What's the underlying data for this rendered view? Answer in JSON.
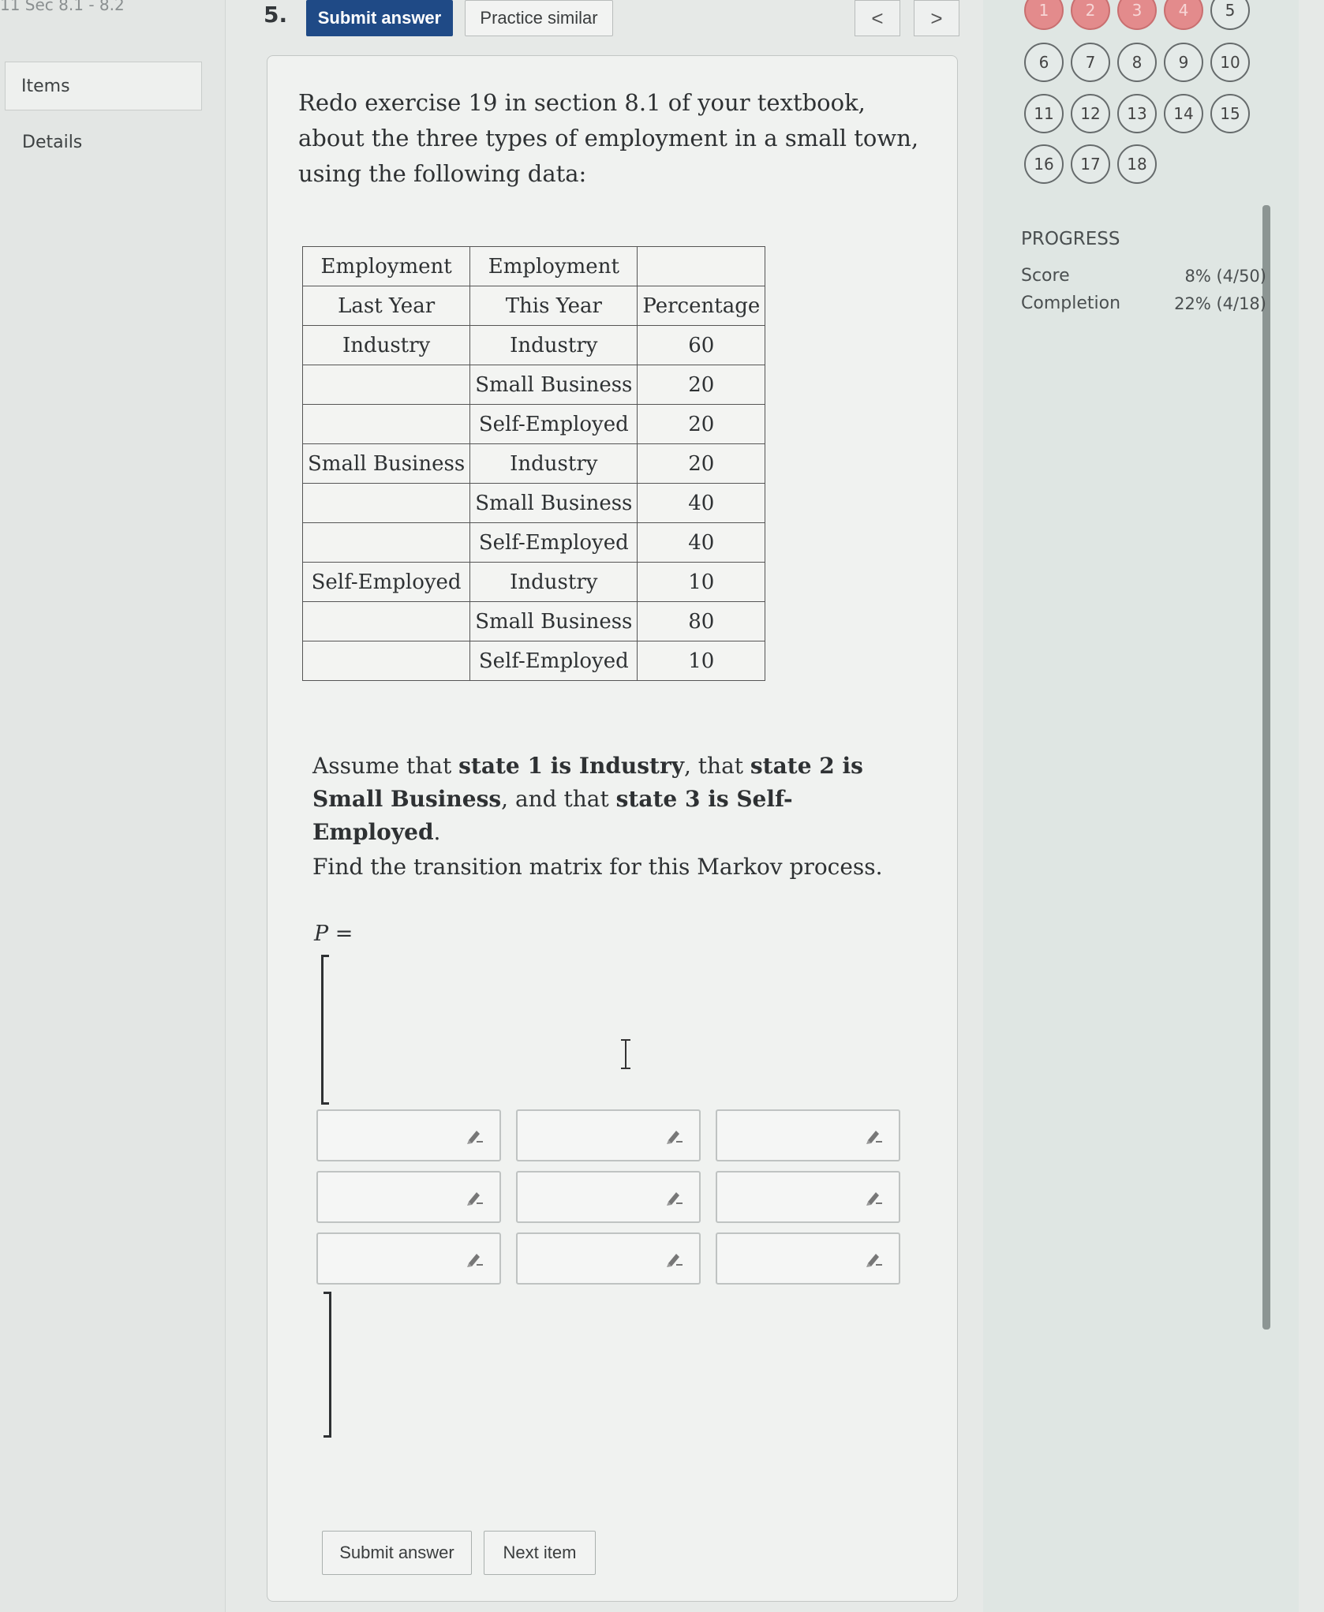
{
  "course_title": "11 Sec 8.1 - 8.2",
  "sidebar": {
    "items_tab": "Items",
    "details_tab": "Details"
  },
  "toolbar": {
    "question_number": "5.",
    "submit_label": "Submit answer",
    "practice_label": "Practice similar",
    "prev_label": "<",
    "next_label": ">"
  },
  "question": {
    "intro": "Redo exercise 19 in section 8.1 of your textbook, about the three types of employment in a small town, using the following data:",
    "table": {
      "headers_row1": [
        "Employment",
        "Employment",
        ""
      ],
      "headers_row2": [
        "Last Year",
        "This Year",
        "Percentage"
      ],
      "rows": [
        [
          "Industry",
          "Industry",
          "60"
        ],
        [
          "",
          "Small Business",
          "20"
        ],
        [
          "",
          "Self-Employed",
          "20"
        ],
        [
          "Small Business",
          "Industry",
          "20"
        ],
        [
          "",
          "Small Business",
          "40"
        ],
        [
          "",
          "Self-Employed",
          "40"
        ],
        [
          "Self-Employed",
          "Industry",
          "10"
        ],
        [
          "",
          "Small Business",
          "80"
        ],
        [
          "",
          "Self-Employed",
          "10"
        ]
      ]
    },
    "assume": {
      "p1": "Assume that ",
      "b1": "state 1 is Industry",
      "p2": ", that ",
      "b2": "state 2 is Small Business",
      "p3": ", and that ",
      "b3": "state 3 is Self-Employed",
      "p4": "."
    },
    "find": "Find the transition matrix for this Markov process.",
    "p_label": "P ="
  },
  "matrix": {
    "cells": [
      [
        "",
        "",
        ""
      ],
      [
        "",
        "",
        ""
      ],
      [
        "",
        "",
        ""
      ]
    ]
  },
  "bottom_buttons": {
    "submit_label": "Submit answer",
    "next_label": "Next item"
  },
  "question_nav": {
    "numbers": [
      "1",
      "2",
      "3",
      "4",
      "5",
      "6",
      "7",
      "8",
      "9",
      "10",
      "11",
      "12",
      "13",
      "14",
      "15",
      "16",
      "17",
      "18"
    ],
    "completed": [
      "1",
      "2",
      "3",
      "4"
    ]
  },
  "progress": {
    "title": "PROGRESS",
    "score_label": "Score",
    "score_value": "8% (4/50)",
    "completion_label": "Completion",
    "completion_value": "22% (4/18)"
  },
  "colors": {
    "primary_button": "#1f4a86",
    "completed_question": "#e38b8c"
  },
  "icons": {
    "pencil": "pencil-icon",
    "text_cursor": "i-beam-cursor-icon"
  }
}
